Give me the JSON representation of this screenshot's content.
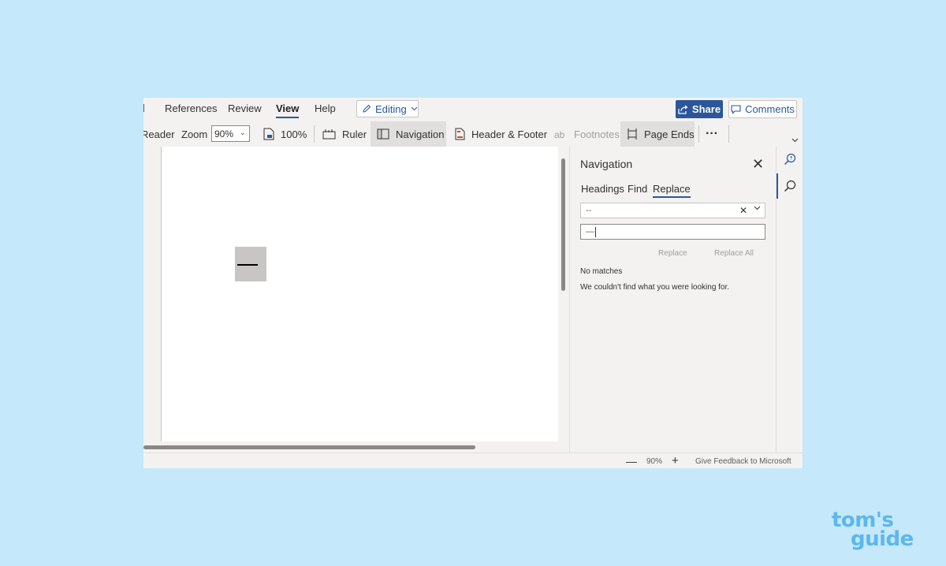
{
  "ribbon": {
    "tabs": [
      {
        "label": "References"
      },
      {
        "label": "Review"
      },
      {
        "label": "View"
      },
      {
        "label": "Help"
      }
    ],
    "editing_label": "Editing",
    "share_label": "Share",
    "comments_label": "Comments"
  },
  "toolbar": {
    "reader_label": "Reader",
    "zoom_label": "Zoom",
    "zoom_value": "90%",
    "hundred_label": "100%",
    "ruler_label": "Ruler",
    "navigation_label": "Navigation",
    "header_footer_label": "Header & Footer",
    "footnotes_label": "Footnotes",
    "page_ends_label": "Page Ends",
    "more_label": "···"
  },
  "navigation_pane": {
    "title": "Navigation",
    "tabs": [
      {
        "label": "Headings"
      },
      {
        "label": "Find"
      },
      {
        "label": "Replace"
      }
    ],
    "find_value": "--",
    "replace_value": "—",
    "replace_button": "Replace",
    "replace_all_button": "Replace All",
    "no_matches": "No matches",
    "no_matches_message": "We couldn't find what you were looking for."
  },
  "status_bar": {
    "minus": "—",
    "zoom": "90%",
    "plus": "+",
    "feedback": "Give Feedback to Microsoft"
  },
  "logo": {
    "line1": "tom's",
    "line2": "guide"
  },
  "colors": {
    "background": "#c5e8fa",
    "accent": "#2b579a",
    "logo": "#5bb7ee"
  }
}
